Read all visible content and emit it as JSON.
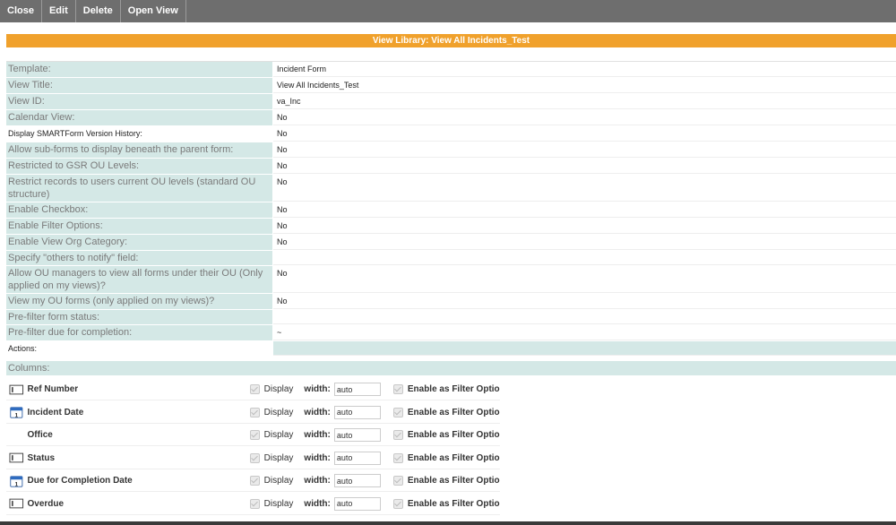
{
  "toolbar": {
    "buttons": [
      "Close",
      "Edit",
      "Delete",
      "Open View"
    ]
  },
  "banner": {
    "title": "View Library: View All Incidents_Test"
  },
  "properties": [
    {
      "label": "Template:",
      "value": "Incident Form"
    },
    {
      "label": "View Title:",
      "value": "View All Incidents_Test"
    },
    {
      "label": "View ID:",
      "value": "va_Inc"
    },
    {
      "label": "Calendar View:",
      "value": "No"
    },
    {
      "label": "Display SMARTForm Version History:",
      "value": "No"
    },
    {
      "label": "Allow sub-forms to display beneath the parent form:",
      "value": "No"
    },
    {
      "label": "Restricted to GSR OU Levels:",
      "value": "No"
    },
    {
      "label": "Restrict records to users current OU levels (standard OU structure)",
      "value": "No"
    },
    {
      "label": "Enable Checkbox:",
      "value": "No"
    },
    {
      "label": "Enable Filter Options:",
      "value": "No"
    },
    {
      "label": "Enable View Org Category:",
      "value": "No"
    },
    {
      "label": "Specify \"others to notify\" field:",
      "value": ""
    },
    {
      "label": "Allow OU managers to view all forms under their OU (Only applied on my views)?",
      "value": "No"
    },
    {
      "label": "View my OU forms (only applied on my views)?",
      "value": "No"
    },
    {
      "label": "Pre-filter form status:",
      "value": ""
    },
    {
      "label": "Pre-filter due for completion:",
      "value": "~"
    },
    {
      "label": "Actions:",
      "value": ""
    }
  ],
  "columns": {
    "header": "Columns:",
    "display_label": "Display",
    "width_label": "width:",
    "filter_label": "Enable as Filter Option",
    "rows": [
      {
        "name": "Ref Number",
        "icon": "text-field-icon",
        "width": "auto"
      },
      {
        "name": "Incident Date",
        "icon": "calendar-icon",
        "width": "auto"
      },
      {
        "name": "Office",
        "icon": "",
        "width": "auto"
      },
      {
        "name": "Status",
        "icon": "text-field-icon",
        "width": "auto"
      },
      {
        "name": "Due for Completion Date",
        "icon": "calendar-icon",
        "width": "auto"
      },
      {
        "name": "Overdue",
        "icon": "text-field-icon",
        "width": "auto"
      }
    ]
  },
  "colors": {
    "toolbar_bg": "#6e6e6e",
    "banner_bg": "#f0a12c",
    "label_bg": "#d4e8e6"
  }
}
